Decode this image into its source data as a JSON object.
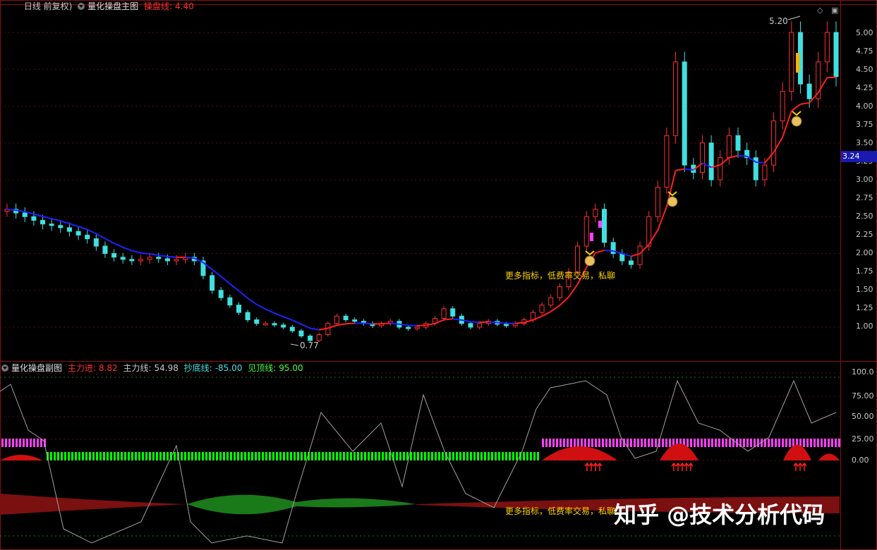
{
  "main_header": {
    "period_label": "日线 前复权)",
    "indicator_name": "量化操盘主图",
    "line_label": "操盘线:",
    "line_value": "4.40"
  },
  "sub_header": {
    "indicator_name": "量化操盘副图",
    "main_in_label": "主力进:",
    "main_in_value": "8.82",
    "main_line_label": "主力线:",
    "main_line_value": "54.98",
    "bottom_line_label": "抄底线:",
    "bottom_line_value": "-85.00",
    "top_line_label": "见顶线:",
    "top_line_value": "95.00"
  },
  "annotations": {
    "high_label": "5.20",
    "low_label": "0.77",
    "promo_main": "更多指标，低费率交易，私聊",
    "promo_sub": "更多指标，低费率交易，私聊",
    "current_price": "3.24"
  },
  "watermark": "知乎 @技术分析代码",
  "colors": {
    "up": "#ff3030",
    "down": "#40e0e0",
    "trend_down": "#2020ff",
    "trend_up": "#ff2020",
    "magenta": "#ff40ff",
    "green": "#00ff00",
    "red_area": "#d01010",
    "dark_red_band": "#7a1010",
    "dark_green_band": "#1a7a1a",
    "gray_line": "#a0a0a0"
  },
  "chart_data": [
    {
      "type": "candlestick",
      "title": "量化操盘主图",
      "ylim": [
        0.6,
        5.3
      ],
      "yticks": [
        "5.00",
        "4.75",
        "4.50",
        "4.25",
        "4.00",
        "3.75",
        "3.50",
        "3.25",
        "3.00",
        "2.75",
        "2.50",
        "2.25",
        "2.00",
        "1.75",
        "1.50",
        "1.25",
        "1.00"
      ],
      "close_approx": [
        2.6,
        2.55,
        2.5,
        2.45,
        2.4,
        2.38,
        2.35,
        2.3,
        2.25,
        2.2,
        2.1,
        2.0,
        1.95,
        1.92,
        1.9,
        1.92,
        1.95,
        1.93,
        1.9,
        1.92,
        1.95,
        1.9,
        1.7,
        1.5,
        1.4,
        1.3,
        1.2,
        1.1,
        1.05,
        1.05,
        1.03,
        1.0,
        0.95,
        0.88,
        0.82,
        0.9,
        1.05,
        1.15,
        1.1,
        1.08,
        1.05,
        1.02,
        1.05,
        1.08,
        1.0,
        0.98,
        1.0,
        1.05,
        1.12,
        1.25,
        1.15,
        1.05,
        1.0,
        1.05,
        1.08,
        1.04,
        1.02,
        1.05,
        1.1,
        1.2,
        1.3,
        1.4,
        1.55,
        1.75,
        2.1,
        2.5,
        2.6,
        2.15,
        2.0,
        1.9,
        1.85,
        2.1,
        2.5,
        2.9,
        3.6,
        4.6,
        3.2,
        3.1,
        3.5,
        3.0,
        3.3,
        3.6,
        3.4,
        3.3,
        3.0,
        3.2,
        3.8,
        4.2,
        5.0,
        4.3,
        4.1,
        4.6,
        5.0,
        4.4
      ],
      "trend_line": {
        "name": "操盘线",
        "value": 4.4
      },
      "high_marker": 5.2,
      "low_marker": 0.77,
      "current_price": 3.24
    },
    {
      "type": "line",
      "title": "量化操盘副图",
      "ylim": [
        -100,
        100
      ],
      "yticks": [
        "100.0",
        "75.00",
        "50.00",
        "25.00",
        "0.00"
      ],
      "series": [
        {
          "name": "主力进",
          "value": 8.82
        },
        {
          "name": "主力线",
          "value": 54.98
        },
        {
          "name": "抄底线",
          "value": -85.0
        },
        {
          "name": "见顶线",
          "value": 95.0
        }
      ]
    }
  ]
}
